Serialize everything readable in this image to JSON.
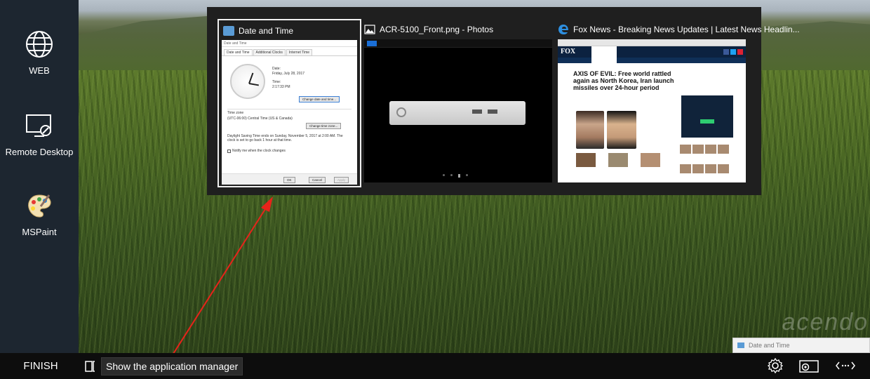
{
  "sidebar": {
    "items": [
      {
        "label": "WEB",
        "icon": "globe-icon"
      },
      {
        "label": "Remote Desktop",
        "icon": "remote-desktop-icon"
      },
      {
        "label": "MSPaint",
        "icon": "paint-palette-icon"
      }
    ]
  },
  "taskbar": {
    "finish_label": "FINISH",
    "tooltip": "Show the application manager",
    "icons": [
      "settings-icon",
      "screen-settings-icon",
      "expand-arrows-icon"
    ]
  },
  "desktop": {
    "watermark": "acendo",
    "notification": "Date and Time"
  },
  "switcher": {
    "windows": [
      {
        "title": "Date and Time",
        "icon": "date-time-icon",
        "selected": true
      },
      {
        "title": "ACR-5100_Front.png - Photos",
        "icon": "photos-icon",
        "selected": false
      },
      {
        "title": "Fox News - Breaking News Updates | Latest News Headlin...",
        "icon": "edge-browser-icon",
        "selected": false
      }
    ]
  },
  "date_time_dialog": {
    "title": "Date and Time",
    "tabs": [
      "Date and Time",
      "Additional Clocks",
      "Internet Time"
    ],
    "date_label": "Date:",
    "date_value": "Friday, July 28, 2017",
    "time_label": "Time:",
    "time_value": "2:17:33 PM",
    "change_button": "Change date and time...",
    "timezone_label": "Time zone",
    "timezone_value": "(UTC-06:00) Central Time (US & Canada)",
    "change_tz_button": "Change time zone...",
    "dst_text": "Daylight Saving Time ends on Sunday, November 5, 2017 at 2:00 AM. The clock is set to go back 1 hour at that time.",
    "notify_label": "Notify me when the clock changes",
    "ok": "OK",
    "cancel": "Cancel",
    "apply": "Apply"
  },
  "news_page": {
    "logo": "FOX",
    "headline": "AXIS OF EVIL: Free world rattled again as North Korea, Iran launch missiles over 24-hour period"
  },
  "colors": {
    "sidebar": "#1d2630",
    "taskbar": "#0d0d0d",
    "switcher": "#1f1f1f",
    "accent_blue": "#1b6fd6"
  }
}
